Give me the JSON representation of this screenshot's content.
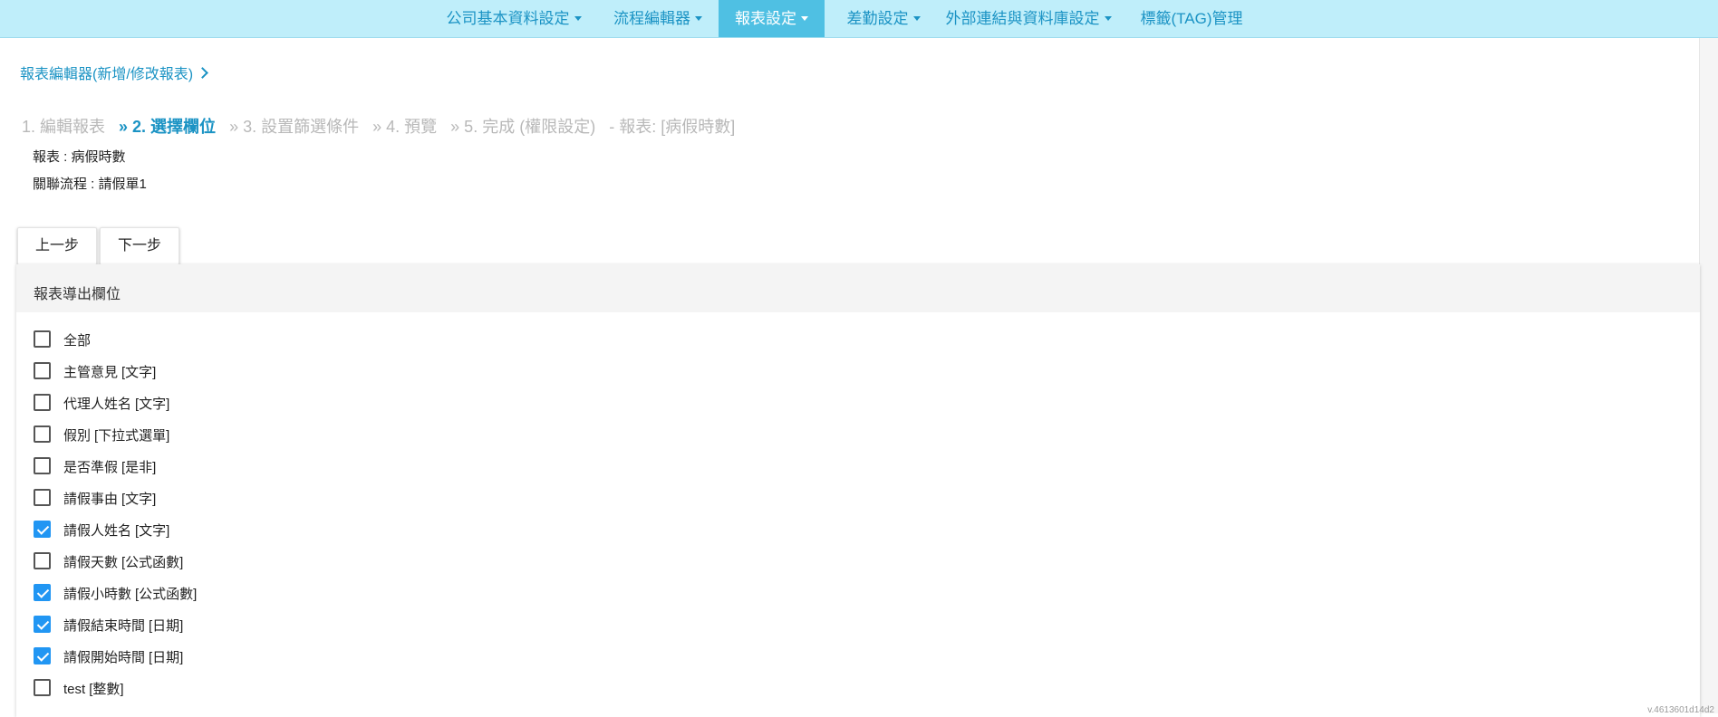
{
  "nav": {
    "items": [
      {
        "label": "公司基本資料設定",
        "active": false
      },
      {
        "label": "流程編輯器",
        "active": false
      },
      {
        "label": "報表設定",
        "active": true
      },
      {
        "label": "差勤設定",
        "active": false
      },
      {
        "label": "外部連結與資料庫設定",
        "active": false
      },
      {
        "label": "標籤(TAG)管理",
        "active": false
      }
    ]
  },
  "breadcrumb": "報表編輯器(新增/修改報表)",
  "steps": [
    {
      "text": "1.  編輯報表",
      "current": false
    },
    {
      "text": "» 2. 選擇欄位",
      "current": true
    },
    {
      "text": "» 3. 設置篩選條件",
      "current": false
    },
    {
      "text": "» 4. 預覽",
      "current": false
    },
    {
      "text": "»  5. 完成 (權限設定)",
      "current": false
    },
    {
      "text": "- 報表: [病假時數]",
      "current": false
    }
  ],
  "info": {
    "report": "報表 : 病假時數",
    "flow": "關聯流程 : 請假單1"
  },
  "buttons": {
    "prev": "上一步",
    "next": "下一步"
  },
  "panel": {
    "title": "報表導出欄位",
    "fields": [
      {
        "name": "全部",
        "type": "",
        "checked": false
      },
      {
        "name": "主管意見",
        "type": "[文字]",
        "checked": false
      },
      {
        "name": "代理人姓名",
        "type": "[文字]",
        "checked": false
      },
      {
        "name": "假別",
        "type": "[下拉式選單]",
        "checked": false
      },
      {
        "name": "是否準假",
        "type": "[是非]",
        "checked": false
      },
      {
        "name": "請假事由",
        "type": "[文字]",
        "checked": false
      },
      {
        "name": "請假人姓名",
        "type": "[文字]",
        "checked": true
      },
      {
        "name": "請假天數",
        "type": "[公式函數]",
        "checked": false
      },
      {
        "name": "請假小時數",
        "type": "[公式函數]",
        "checked": true
      },
      {
        "name": "請假結束時間",
        "type": "[日期]",
        "checked": true
      },
      {
        "name": "請假開始時間",
        "type": "[日期]",
        "checked": true
      },
      {
        "name": "test",
        "type": "[整數]",
        "checked": false
      }
    ]
  },
  "colors": {
    "nav_bg": "#bfeefa",
    "nav_active": "#4fc0e3",
    "link": "#1b93c4",
    "checkbox_on": "#2196f3"
  },
  "footnote": "v.4613601d14d2"
}
